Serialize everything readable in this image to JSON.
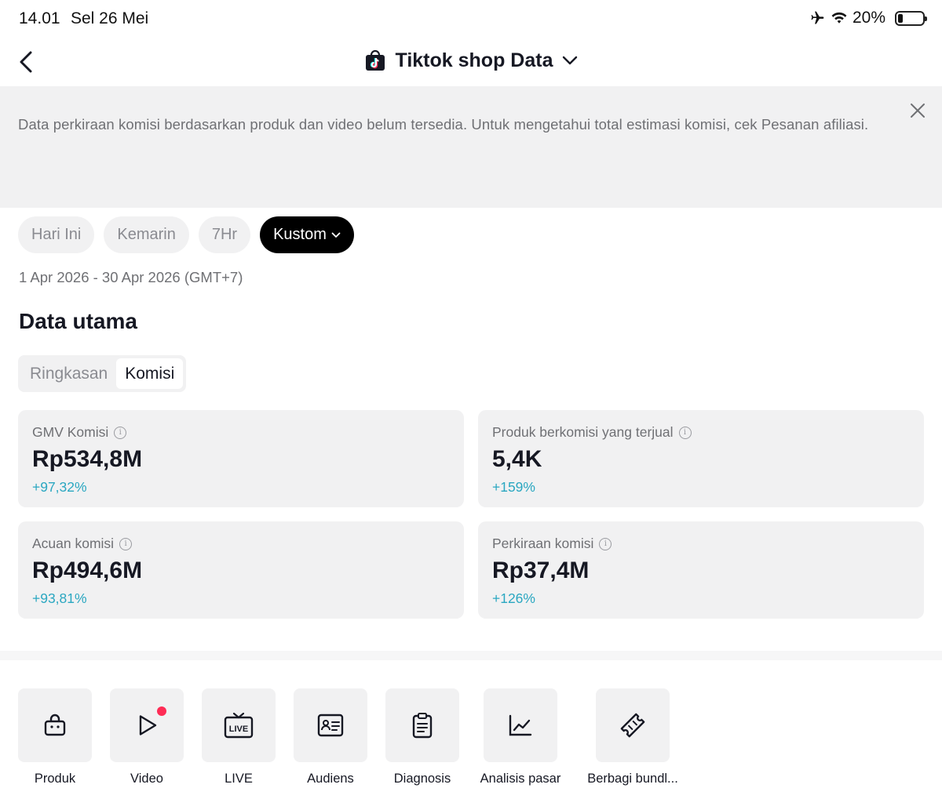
{
  "status_bar": {
    "time": "14.01",
    "date": "Sel 26 Mei",
    "battery": "20%",
    "icons": [
      "airplane-icon",
      "wifi-icon",
      "battery-icon"
    ]
  },
  "header": {
    "title": "Tiktok shop Data",
    "icons": [
      "back-icon",
      "tiktok-shop-icon",
      "chevron-down-icon"
    ]
  },
  "banner": {
    "text": "Data perkiraan komisi berdasarkan produk dan video belum tersedia. Untuk mengetahui total estimasi komisi, cek Pesanan afiliasi.",
    "close_icon": "close-icon"
  },
  "filters": {
    "chips": [
      "Hari Ini",
      "Kemarin",
      "7Hr",
      "Kustom"
    ],
    "active": "Kustom",
    "date_range": "1 Apr 2026 - 30 Apr 2026 (GMT+7)"
  },
  "main": {
    "section_title": "Data utama",
    "tabs": [
      "Ringkasan",
      "Komisi"
    ],
    "active_tab": "Komisi",
    "metrics": [
      {
        "label": "GMV Komisi",
        "value": "Rp534,8M",
        "delta": "+97,32%"
      },
      {
        "label": "Produk berkomisi yang terjual",
        "value": "5,4K",
        "delta": "+159%"
      },
      {
        "label": "Acuan komisi",
        "value": "Rp494,6M",
        "delta": "+93,81%"
      },
      {
        "label": "Perkiraan komisi",
        "value": "Rp37,4M",
        "delta": "+126%"
      }
    ]
  },
  "tools": [
    {
      "label": "Produk",
      "icon": "shopping-bag-icon"
    },
    {
      "label": "Video",
      "icon": "play-icon",
      "badge": true
    },
    {
      "label": "LIVE",
      "icon": "live-tv-icon"
    },
    {
      "label": "Audiens",
      "icon": "id-card-icon"
    },
    {
      "label": "Diagnosis",
      "icon": "clipboard-icon"
    },
    {
      "label": "Analisis pasar",
      "icon": "line-chart-icon"
    },
    {
      "label": "Berbagi bundl...",
      "icon": "ticket-icon"
    }
  ],
  "colors": {
    "accent_positive": "#2aa7c1",
    "chip_active": "#000000",
    "card_bg": "#f1f1f2",
    "badge": "#fe2c55"
  }
}
